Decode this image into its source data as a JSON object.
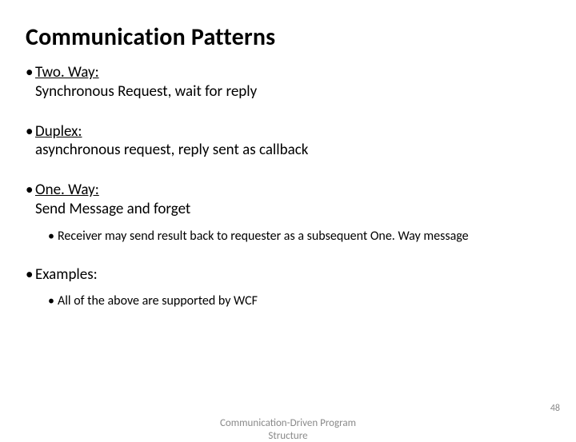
{
  "title": "Communication Patterns",
  "items": [
    {
      "head": "Two. Way:",
      "body": "Synchronous Request, wait for reply"
    },
    {
      "head": "Duplex:",
      "body": "asynchronous request, reply sent as callback"
    },
    {
      "head": "One. Way:",
      "body": "Send Message and forget"
    }
  ],
  "sub_after_oneway": "Receiver may send result back to requester as a subsequent One. Way message",
  "examples_label": "Examples:",
  "examples_sub": "All of the above are supported by WCF",
  "footer": {
    "center_line1": "Communication-Driven Program",
    "center_line2": "Structure",
    "page": "48"
  },
  "bullet": "•"
}
